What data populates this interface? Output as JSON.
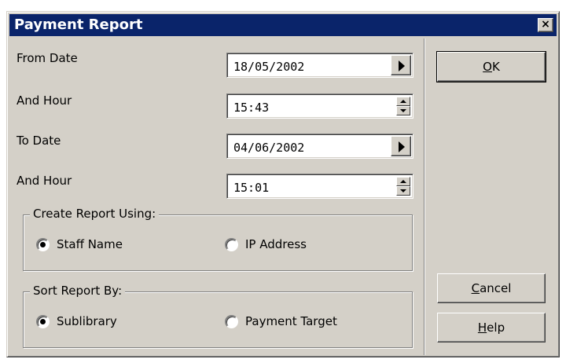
{
  "window": {
    "title": "Payment Report",
    "close_glyph": "×",
    "colors": {
      "titlebar": "#0a246a",
      "face": "#d4d0c8"
    }
  },
  "fields": {
    "from_date": {
      "label": "From Date",
      "value": "18/05/2002",
      "button_icon": "right-arrow-icon"
    },
    "from_hour": {
      "label": "And Hour",
      "value": "15:43",
      "button_icon": "spin-up-down-icon"
    },
    "to_date": {
      "label": "To Date",
      "value": "04/06/2002",
      "button_icon": "right-arrow-icon"
    },
    "to_hour": {
      "label": "And Hour",
      "value": "15:01",
      "button_icon": "spin-up-down-icon"
    }
  },
  "create_report": {
    "label": "Create Report Using:",
    "options": [
      {
        "label": "Staff Name",
        "selected": true
      },
      {
        "label": "IP Address",
        "selected": false
      }
    ]
  },
  "sort_report": {
    "label": "Sort Report By:",
    "options": [
      {
        "label": "Sublibrary",
        "selected": true
      },
      {
        "label": "Payment Target",
        "selected": false
      }
    ]
  },
  "buttons": {
    "ok": {
      "mnemonic": "O",
      "rest": "K"
    },
    "cancel": {
      "mnemonic": "C",
      "rest": "ancel"
    },
    "help": {
      "mnemonic": "H",
      "rest": "elp"
    }
  }
}
